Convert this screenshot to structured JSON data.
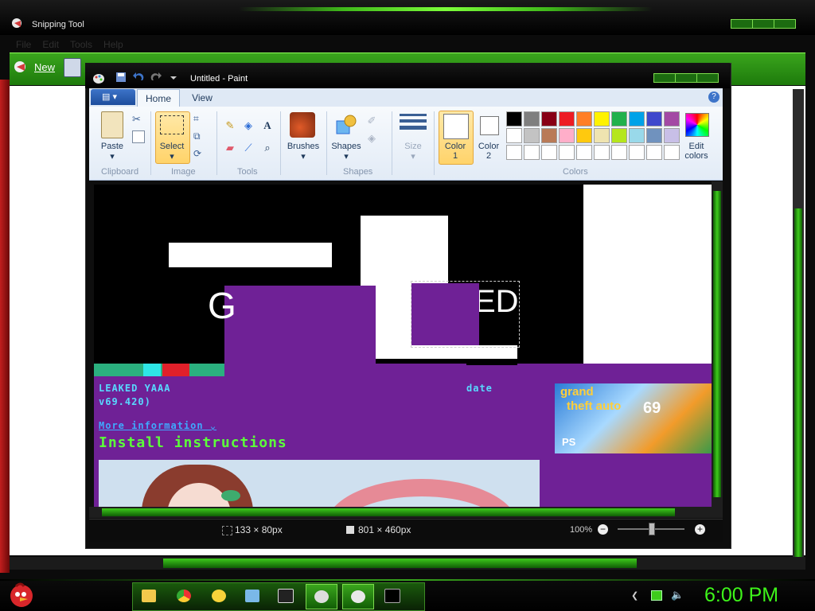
{
  "snipping_tool": {
    "title": "Snipping Tool",
    "menu": [
      "File",
      "Edit",
      "Tools",
      "Help"
    ],
    "toolbar": {
      "new_label": "New"
    }
  },
  "paint": {
    "title": "Untitled - Paint",
    "tabs": [
      "Home",
      "View"
    ],
    "groups": {
      "clipboard": "Clipboard",
      "image": "Image",
      "tools": "Tools",
      "shapes": "Shapes",
      "colors": "Colors"
    },
    "buttons": {
      "paste": "Paste",
      "select": "Select",
      "brushes": "Brushes",
      "shapes": "Shapes",
      "size": "Size",
      "color1": "Color\n1",
      "color2": "Color\n2",
      "edit_colors": "Edit\ncolors"
    },
    "palette": [
      "#000000",
      "#7f7f7f",
      "#880015",
      "#ed1c24",
      "#ff7f27",
      "#fff200",
      "#22b14c",
      "#00a2e8",
      "#3f48cc",
      "#a349a4",
      "#ffffff",
      "#c3c3c3",
      "#b97a57",
      "#ffaec9",
      "#ffc90e",
      "#efe4b0",
      "#b5e61d",
      "#99d9ea",
      "#7092be",
      "#c8bfe7",
      "#ffffff",
      "#ffffff",
      "#ffffff",
      "#ffffff",
      "#ffffff",
      "#ffffff",
      "#ffffff",
      "#ffffff",
      "#ffffff",
      "#ffffff"
    ],
    "status": {
      "selection_size": "133 × 80px",
      "image_size": "801 × 460px",
      "zoom": "100%"
    },
    "canvas_text": {
      "leaked": "LEAKED YAAA",
      "version": "v69.420)",
      "date": "date",
      "more_info": "More information ⌄",
      "install": "Install instructions",
      "g_letter": "G",
      "ed_letters": "ED",
      "cover_line1": "grand",
      "cover_line2": "theft auto",
      "cover_num": "69",
      "cover_ps": "PS"
    }
  },
  "taskbar": {
    "clock": "6:00 PM"
  },
  "colors": {
    "accent": "#3ecb1c",
    "purple": "#6f2196"
  }
}
